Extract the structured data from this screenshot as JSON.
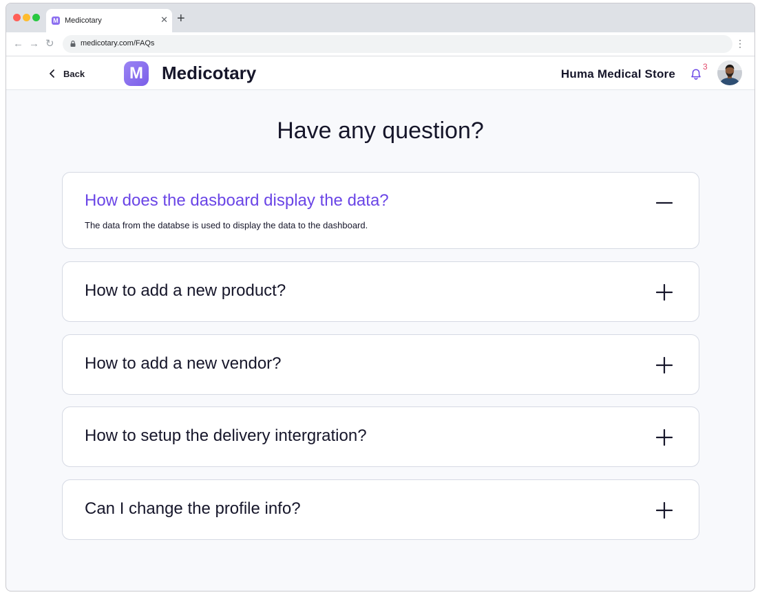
{
  "browser": {
    "tab_title": "Medicotary",
    "tab_favicon": "M",
    "tab_close": "✕",
    "new_tab": "+",
    "url": "medicotary.com/FAQs",
    "back_arrow": "←",
    "forward_arrow": "→",
    "reload": "↻",
    "menu": "⋮",
    "traffic_colors": [
      "#ff5f57",
      "#febc2e",
      "#28c840"
    ]
  },
  "header": {
    "back_label": "Back",
    "logo_letter": "M",
    "brand": "Medicotary",
    "store_name": "Huma Medical Store",
    "notification_count": "3",
    "accent_color": "#6a45e6"
  },
  "page": {
    "title": "Have any question?"
  },
  "faqs": [
    {
      "question": "How does the dasboard display the data?",
      "answer": "The data from the databse is used to display the data to the dashboard.",
      "expanded": true,
      "toggle_icon": "minus-icon"
    },
    {
      "question": "How to add a new product?",
      "answer": "",
      "expanded": false,
      "toggle_icon": "plus-icon"
    },
    {
      "question": "How to add a new vendor?",
      "answer": "",
      "expanded": false,
      "toggle_icon": "plus-icon"
    },
    {
      "question": "How to setup the delivery intergration?",
      "answer": "",
      "expanded": false,
      "toggle_icon": "plus-icon"
    },
    {
      "question": "Can I change the profile info?",
      "answer": "",
      "expanded": false,
      "toggle_icon": "plus-icon"
    }
  ]
}
